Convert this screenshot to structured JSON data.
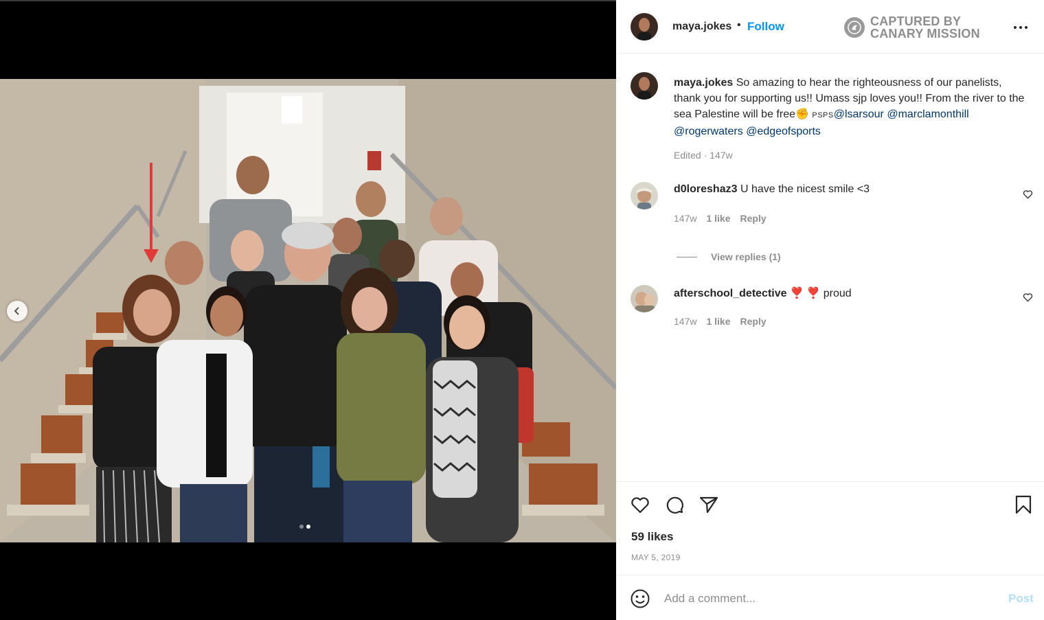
{
  "post": {
    "username": "maya.jokes",
    "bullet": "•",
    "follow_label": "Follow",
    "watermark_line1": "CAPTURED BY",
    "watermark_line2": "CANARY MISSION",
    "more_icon": "more-horizontal-icon"
  },
  "caption": {
    "username": "maya.jokes",
    "text": " So amazing to hear the righteousness of our panelists, thank you for supporting us!! Umass sjp loves you!! From the river to the sea Palestine will be free",
    "emoji": "✊",
    "ps": "PSPS",
    "mentions": [
      "@lsarsour",
      "@marclamonthill",
      "@rogerwaters",
      "@edgeofsports"
    ],
    "edited": "Edited",
    "dot": "·",
    "age": "147w"
  },
  "comments": [
    {
      "username": "d0loreshaz3",
      "text": "U have the nicest smile <3",
      "age": "147w",
      "likes": "1 like",
      "reply_label": "Reply",
      "view_replies": "View replies (1)"
    },
    {
      "username": "afterschool_detective",
      "emoji": "❣️ ❣️",
      "text": "proud",
      "age": "147w",
      "likes": "1 like",
      "reply_label": "Reply"
    }
  ],
  "actions": {
    "icons": [
      "heart-icon",
      "comment-icon",
      "share-icon",
      "bookmark-icon"
    ],
    "likes_count": "59 likes",
    "date": "MAY 5, 2019"
  },
  "comment_box": {
    "placeholder": "Add a comment...",
    "post_label": "Post",
    "emoji_icon": "smiley-icon"
  },
  "colors": {
    "follow_blue": "#0095f6",
    "mention_blue": "#00376b",
    "muted_gray": "#8e8e8e",
    "post_disabled": "#b2dffc",
    "annotation_red": "#e03a3a"
  }
}
